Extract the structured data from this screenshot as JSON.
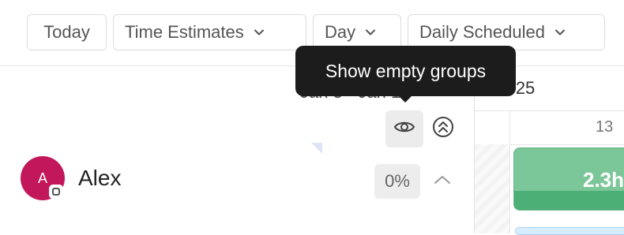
{
  "toolbar": {
    "today_label": "Today",
    "estimates_label": "Time Estimates",
    "day_label": "Day",
    "daily_scheduled_label": "Daily Scheduled"
  },
  "header": {
    "date_range": "Jan 5 - Jan 11",
    "month_label": "n 2025"
  },
  "tooltip": {
    "text": "Show empty groups"
  },
  "calendar": {
    "day_number": "13",
    "bar_value": "2.3h"
  },
  "user": {
    "initial": "A",
    "name": "Alex",
    "percent": "0%"
  },
  "icons": {
    "eye": "eye-icon",
    "collapse": "collapse-all-icon",
    "chevron_up": "chevron-up-icon",
    "chevron_down": "chevron-down-icon"
  },
  "colors": {
    "avatar": "#c2185b",
    "bar_green": "#7cc79a",
    "bar_strip": "#4caf75",
    "tooltip_bg": "#1c1c1c"
  }
}
